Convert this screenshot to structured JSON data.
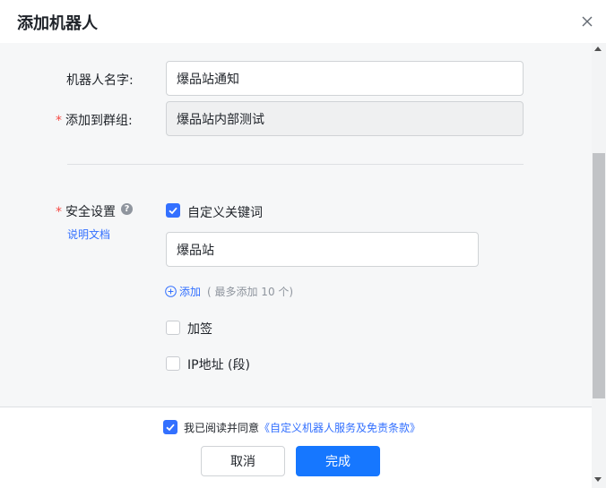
{
  "dialog": {
    "title": "添加机器人",
    "close_icon": "close-icon"
  },
  "form": {
    "bot_name": {
      "label": "机器人名字:",
      "value": "爆品站通知"
    },
    "group": {
      "label": "添加到群组:",
      "required_mark": "*",
      "value": "爆品站内部测试"
    },
    "security": {
      "label": "安全设置",
      "required_mark": "*",
      "help_icon": "question-circle-icon",
      "help_glyph": "?",
      "doc_link": "说明文档",
      "keyword_option": {
        "label": "自定义关键词",
        "checked": true
      },
      "keyword_value": "爆品站",
      "add_label": "添加",
      "add_hint": "( 最多添加 10 个)",
      "sign_option": {
        "label": "加签",
        "checked": false
      },
      "ip_option": {
        "label": "IP地址 (段)",
        "checked": false
      }
    }
  },
  "footer": {
    "agree_checked": true,
    "agree_prefix": "我已阅读并同意",
    "agree_link": "《自定义机器人服务及免责条款》",
    "cancel_label": "取消",
    "confirm_label": "完成"
  },
  "colors": {
    "accent": "#3370ff",
    "primary_button": "#1677ff",
    "required": "#f54a45"
  }
}
